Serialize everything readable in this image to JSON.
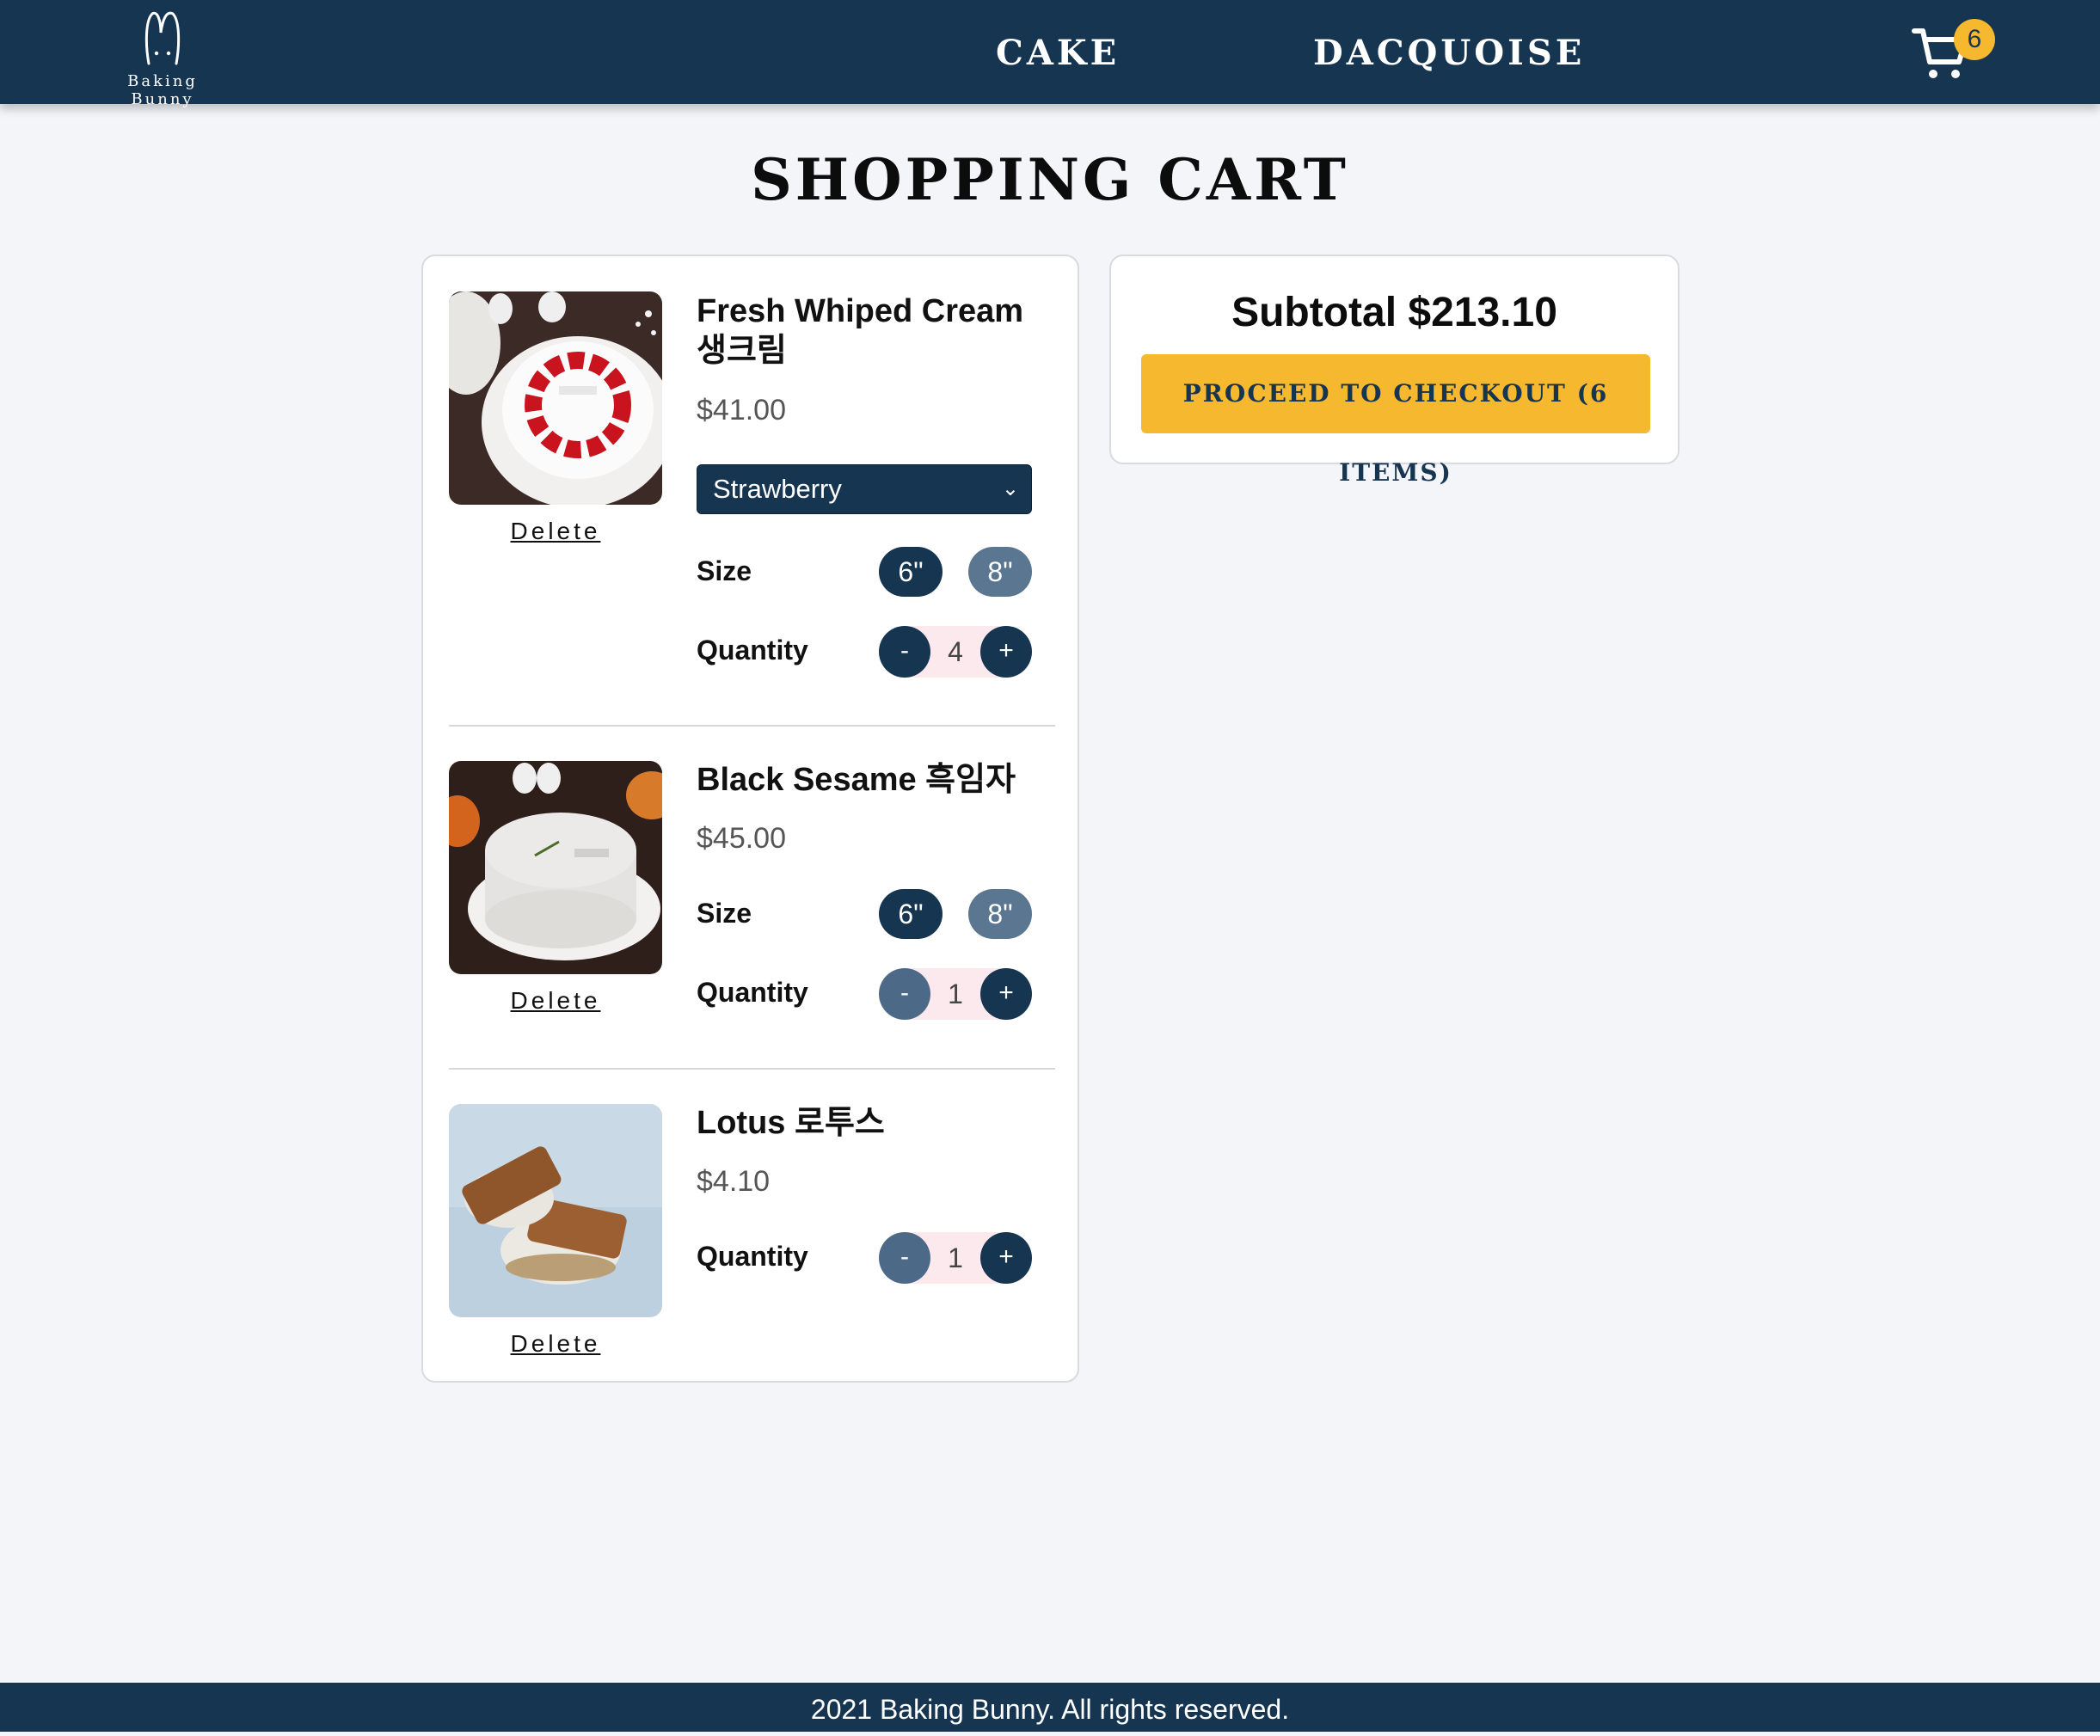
{
  "brand": {
    "name": "Baking Bunny"
  },
  "nav": {
    "links": [
      "CAKE",
      "DACQUOISE"
    ]
  },
  "cart": {
    "count": "6"
  },
  "page": {
    "title": "SHOPPING CART"
  },
  "items": [
    {
      "name": "Fresh Whiped Cream 생크림",
      "price": "$41.00",
      "flavor": "Strawberry",
      "size_label": "Size",
      "sizes": [
        "6\"",
        "8\""
      ],
      "selected_size": "6\"",
      "qty_label": "Quantity",
      "quantity": "4",
      "minus": "-",
      "plus": "+",
      "delete": "Delete"
    },
    {
      "name": "Black Sesame 흑임자",
      "price": "$45.00",
      "size_label": "Size",
      "sizes": [
        "6\"",
        "8\""
      ],
      "selected_size": "6\"",
      "qty_label": "Quantity",
      "quantity": "1",
      "minus": "-",
      "plus": "+",
      "delete": "Delete"
    },
    {
      "name": "Lotus 로투스",
      "price": "$4.10",
      "qty_label": "Quantity",
      "quantity": "1",
      "minus": "-",
      "plus": "+",
      "delete": "Delete"
    }
  ],
  "summary": {
    "subtotal": "Subtotal $213.10",
    "checkout": "PROCEED TO CHECKOUT (6 ITEMS)"
  },
  "footer": {
    "text": "2021 Baking Bunny. All rights reserved."
  },
  "colors": {
    "navy": "#163550",
    "accent": "#f5b82e",
    "unselected": "#5a7690",
    "disabled_minus": "#4c6a88",
    "qty_bg": "#fbe9ee",
    "background": "#f4f5f9"
  }
}
